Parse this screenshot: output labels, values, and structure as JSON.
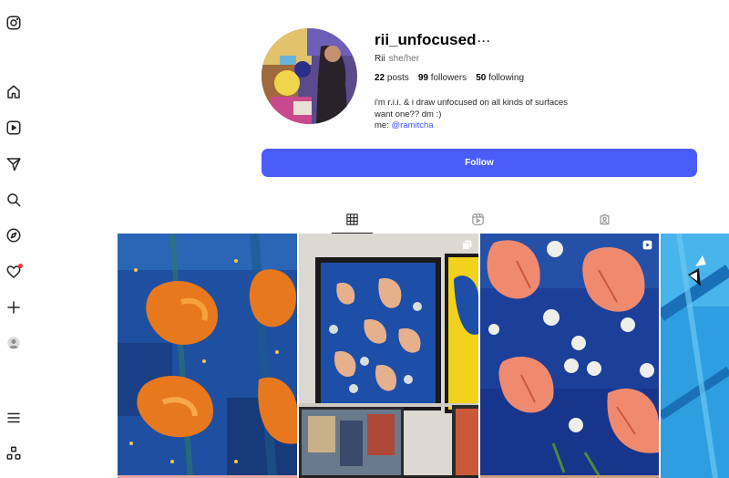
{
  "profile": {
    "username": "rii_unfocused",
    "more_label": "···",
    "full_name": "Rii",
    "pronouns": "she/her",
    "posts_count": "22",
    "posts_label": "posts",
    "followers_count": "99",
    "followers_label": "followers",
    "following_count": "50",
    "following_label": "following",
    "bio_line1": "i'm r.i.i. & i draw unfocused on all kinds of surfaces",
    "bio_line2": "want one?? dm :)",
    "bio_me_prefix": "me: ",
    "bio_mention": "@ramitcha",
    "follow_label": "Follow"
  },
  "sidebar": {
    "icons": [
      "instagram-logo-icon",
      "home-icon",
      "reels-icon",
      "messages-icon",
      "search-icon",
      "explore-icon",
      "notifications-icon",
      "create-icon",
      "profile-icon",
      "menu-icon",
      "more-apps-icon"
    ]
  },
  "tabs": [
    "posts-grid-icon",
    "reels-icon",
    "tagged-icon"
  ],
  "colors": {
    "accent": "#4a5df9",
    "mention": "#4150f7",
    "notification_dot": "#ff3040"
  }
}
